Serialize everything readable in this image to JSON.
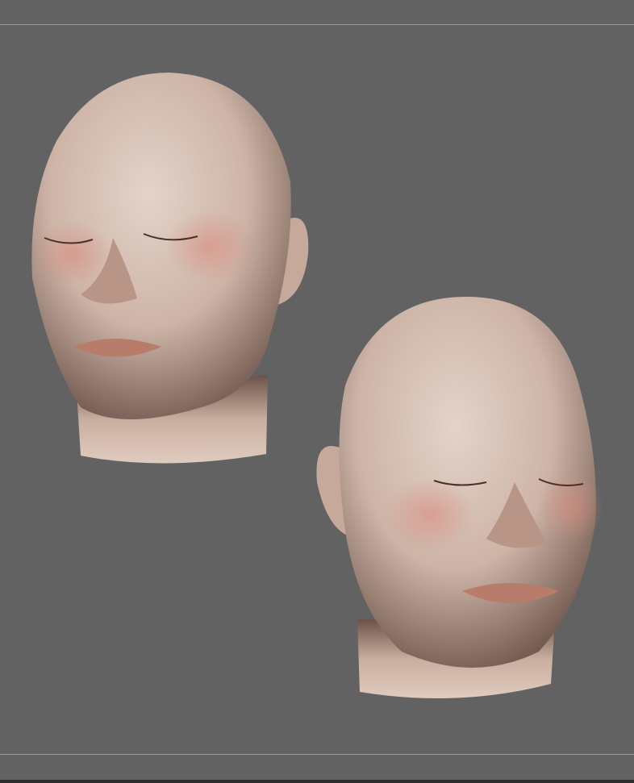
{
  "viewport": {
    "background_color": "#626262",
    "divider_color": "#9a9a9a",
    "skin_color": "#d6c0b4",
    "lip_color": "#b87c6a",
    "models": [
      {
        "name": "head-sculpt-left",
        "orientation": "three-quarter-right"
      },
      {
        "name": "head-sculpt-right",
        "orientation": "three-quarter-left"
      }
    ]
  }
}
